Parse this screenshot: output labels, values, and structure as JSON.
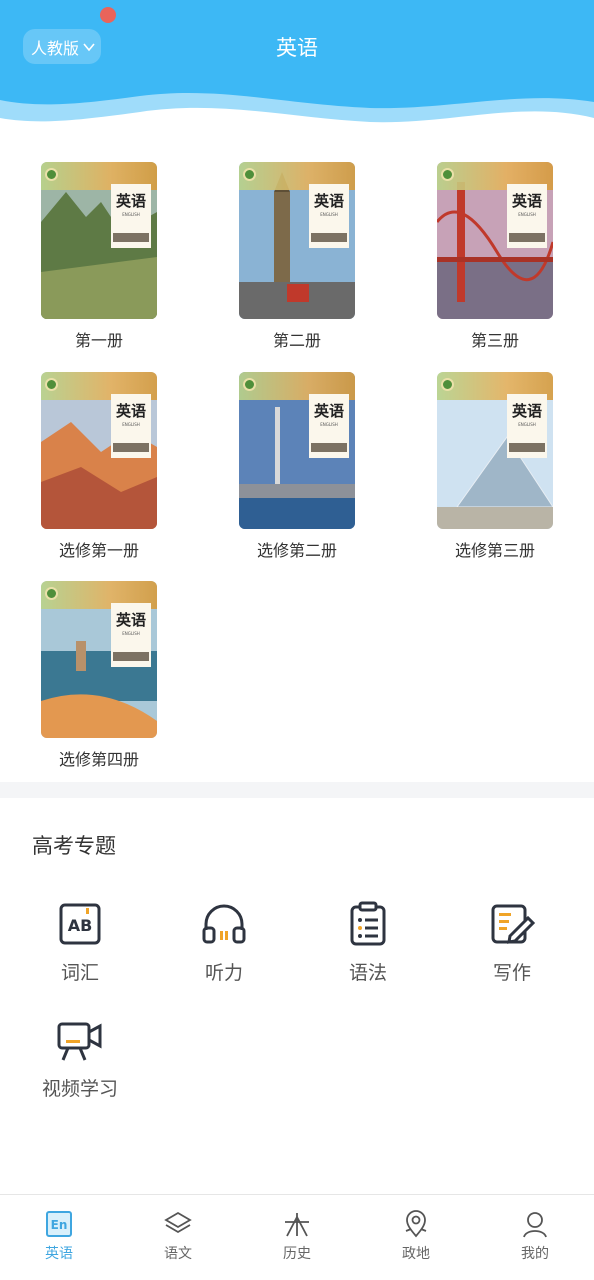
{
  "header": {
    "edition_label": "人教版",
    "title": "英语"
  },
  "books": [
    {
      "name": "第一册",
      "cover_title": "英语",
      "cover_subtitle": "ENGLISH"
    },
    {
      "name": "第二册",
      "cover_title": "英语",
      "cover_subtitle": "ENGLISH"
    },
    {
      "name": "第三册",
      "cover_title": "英语",
      "cover_subtitle": "ENGLISH"
    },
    {
      "name": "选修第一册",
      "cover_title": "英语",
      "cover_subtitle": "ENGLISH"
    },
    {
      "name": "选修第二册",
      "cover_title": "英语",
      "cover_subtitle": "ENGLISH"
    },
    {
      "name": "选修第三册",
      "cover_title": "英语",
      "cover_subtitle": "ENGLISH"
    },
    {
      "name": "选修第四册",
      "cover_title": "英语",
      "cover_subtitle": "ENGLISH"
    }
  ],
  "gaokao": {
    "title": "高考专题",
    "items": [
      {
        "label": "词汇",
        "icon": "ab-vocabulary-icon"
      },
      {
        "label": "听力",
        "icon": "headphones-icon"
      },
      {
        "label": "语法",
        "icon": "clipboard-list-icon"
      },
      {
        "label": "写作",
        "icon": "note-pen-icon"
      },
      {
        "label": "视频学习",
        "icon": "video-camera-icon"
      }
    ]
  },
  "bottom_nav": [
    {
      "label": "英语",
      "icon": "en-icon",
      "active": true
    },
    {
      "label": "语文",
      "icon": "layers-icon",
      "active": false
    },
    {
      "label": "历史",
      "icon": "history-icon",
      "active": false
    },
    {
      "label": "政地",
      "icon": "map-pin-icon",
      "active": false
    },
    {
      "label": "我的",
      "icon": "user-icon",
      "active": false
    }
  ],
  "colors": {
    "accent": "#3fa6e0",
    "header_blue": "#3db8f5",
    "icon_dark": "#2e3440",
    "icon_orange": "#f0a428",
    "red_dot": "#e9645b"
  }
}
